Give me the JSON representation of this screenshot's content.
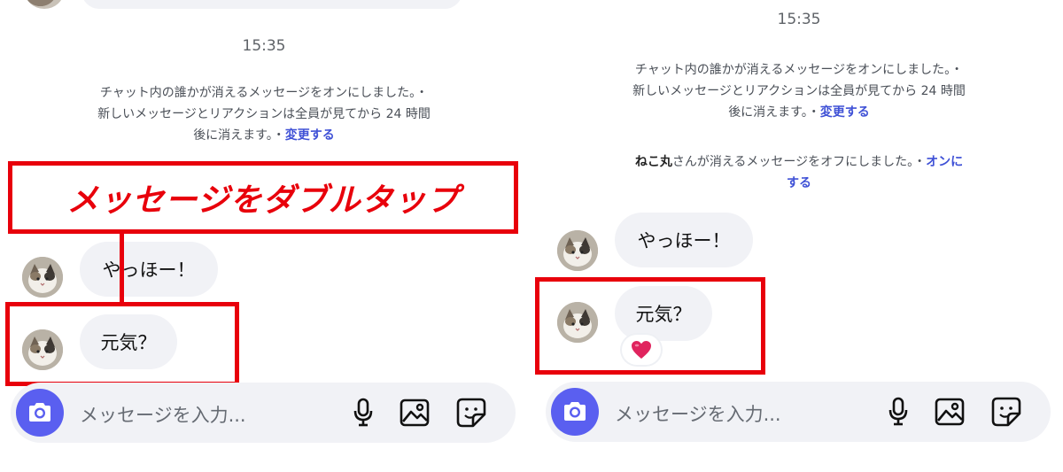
{
  "left": {
    "time": "15:35",
    "system_notice": {
      "line1": "チャット内の誰かが消えるメッセージをオンにしました。・",
      "line2": "新しいメッセージとリアクションは全員が見てから 24 時間",
      "line3_prefix": "後に消えます。・",
      "link": "変更する"
    },
    "callout": "メッセージをダブルタップ",
    "messages": [
      {
        "text": "やっほー！"
      },
      {
        "text": "元気？"
      }
    ],
    "composer": {
      "placeholder": "メッセージを入力..."
    }
  },
  "right": {
    "time": "15:35",
    "system_notice": {
      "line1": "チャット内の誰かが消えるメッセージをオンにしました。・",
      "line2": "新しいメッセージとリアクションは全員が見てから 24 時間",
      "line3_prefix": "後に消えます。・",
      "link": "変更する"
    },
    "notice2": {
      "name": "ねこ丸",
      "text": "さんが消えるメッセージをオフにしました。・",
      "link_part1": "オンに",
      "link_part2": "する"
    },
    "messages": [
      {
        "text": "やっほー！"
      },
      {
        "text": "元気？",
        "reaction": "heart-emoji"
      }
    ],
    "composer": {
      "placeholder": "メッセージを入力..."
    }
  },
  "icons": {
    "camera": "camera-icon",
    "mic": "microphone-icon",
    "gallery": "image-icon",
    "sticker": "sticker-icon",
    "reaction": "heart-icon"
  },
  "colors": {
    "accent": "#5a5ff0",
    "link": "#3f51d6",
    "highlight": "#e8000b",
    "bubble": "#f1f2f6",
    "heart": "#e0245e"
  }
}
